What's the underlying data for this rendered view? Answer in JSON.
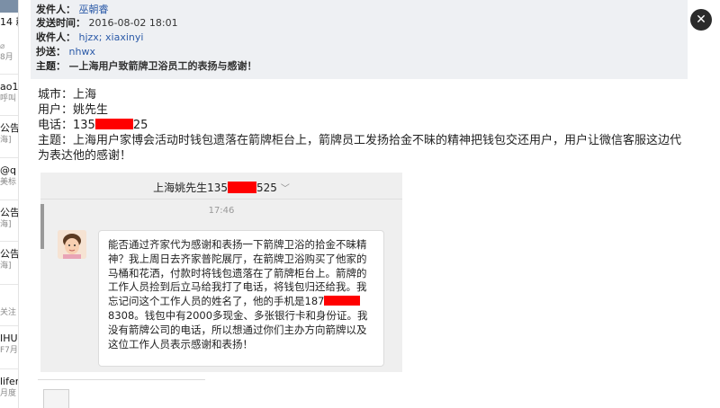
{
  "left_list": {
    "items": [
      {
        "l1": "14 耕",
        "l2": ""
      },
      {
        "l1": "",
        "l2": "8月"
      },
      {
        "l1": "ao1",
        "l2": "呼叫"
      },
      {
        "l1": "公告",
        "l2": "海]"
      },
      {
        "l1": "@q",
        "l2": "美标"
      },
      {
        "l1": "公告",
        "l2": "海]"
      },
      {
        "l1": "公告",
        "l2": "海]"
      },
      {
        "l1": "",
        "l2": "关注"
      },
      {
        "l1": "IHU",
        "l2": "F7月"
      },
      {
        "l1": "lifer",
        "l2": "月度"
      }
    ]
  },
  "header": {
    "from_label": "发件人：",
    "from_value": "巫朝睿",
    "time_label": "发送时间：",
    "time_value": "2016-08-02 18:01",
    "to_label": "收件人：",
    "to_value": "hjzx; xiaxinyi",
    "cc_label": "抄送：",
    "cc_value": "nhwx",
    "subject_label": "主题：",
    "subject_value": "—上海用户致箭牌卫浴员工的表扬与感谢！"
  },
  "close_button": {
    "label": "✕"
  },
  "body": {
    "city": "城市：上海",
    "user": "用户：姚先生",
    "phone_prefix": "电话：135",
    "phone_suffix": "25",
    "subject_line": "主题：上海用户家博会活动时钱包遗落在箭牌柜台上，箭牌员工发扬拾金不昧的精神把钱包交还用户，用户让微信客服这边代为表达他的感谢！"
  },
  "chat": {
    "title_prefix": "上海姚先生135",
    "title_suffix": "525",
    "chevron": "﹀",
    "time": "17:46",
    "message_part1": "能否通过齐家代为感谢和表扬一下箭牌卫浴的拾金不昧精神？我上周日去齐家普陀展厅，在箭牌卫浴购买了他家的马桶和花洒，付款时将钱包遗落在了箭牌柜台上。箭牌的工作人员捡到后立马给我打了电话，将钱包归还给我。我忘记问这个工作人员的姓名了，他的手机是187",
    "message_part2": "8308。钱包中有2000多现金、多张银行卡和身份证。我没有箭牌公司的电话，所以想通过你们主办方向箭牌以及这位工作人员表示感谢和表扬！"
  },
  "colors": {
    "header_bg": "#eef0f3",
    "link": "#2b5aa8",
    "redaction": "#ff0000",
    "chat_bg": "#efefef"
  }
}
